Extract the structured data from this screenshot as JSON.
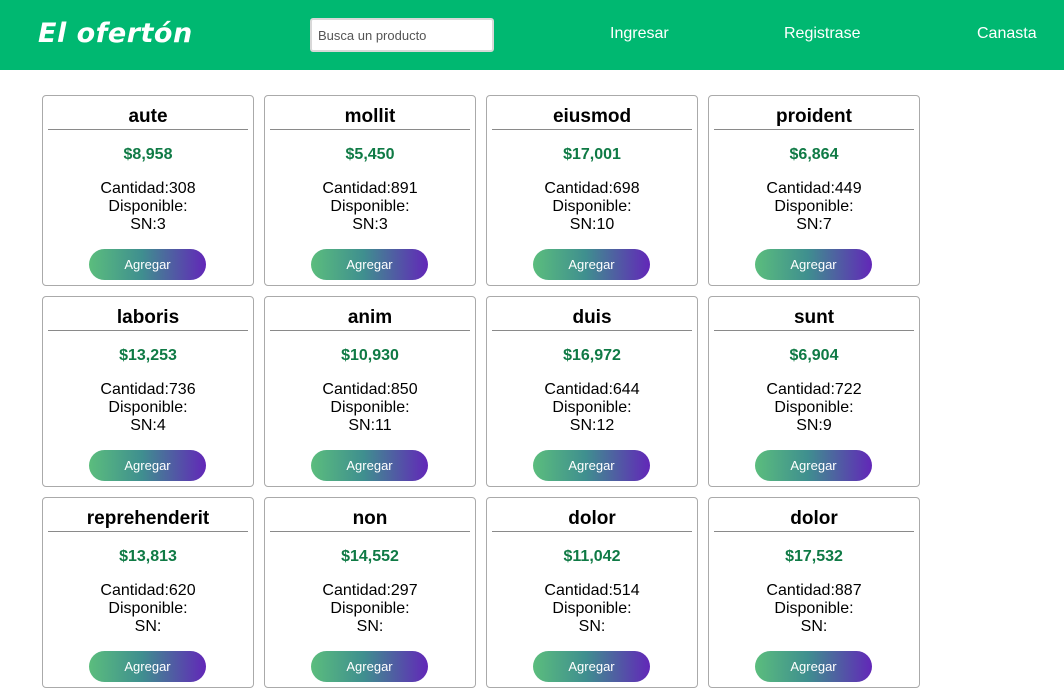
{
  "header": {
    "logo": "El ofertón",
    "search_placeholder": "Busca un producto",
    "nav": {
      "login": "Ingresar",
      "register": "Registrase",
      "cart": "Canasta"
    }
  },
  "labels": {
    "quantity": "Cantidad:",
    "available": "Disponible:",
    "sn": "SN:",
    "add": "Agregar"
  },
  "products": [
    {
      "name": "aute",
      "price": "$8,958",
      "quantity": "308",
      "sn": "3"
    },
    {
      "name": "mollit",
      "price": "$5,450",
      "quantity": "891",
      "sn": "3"
    },
    {
      "name": "eiusmod",
      "price": "$17,001",
      "quantity": "698",
      "sn": "10"
    },
    {
      "name": "proident",
      "price": "$6,864",
      "quantity": "449",
      "sn": "7"
    },
    {
      "name": "laboris",
      "price": "$13,253",
      "quantity": "736",
      "sn": "4"
    },
    {
      "name": "anim",
      "price": "$10,930",
      "quantity": "850",
      "sn": "11"
    },
    {
      "name": "duis",
      "price": "$16,972",
      "quantity": "644",
      "sn": "12"
    },
    {
      "name": "sunt",
      "price": "$6,904",
      "quantity": "722",
      "sn": "9"
    },
    {
      "name": "reprehenderit",
      "price": "$13,813",
      "quantity": "620",
      "sn": ""
    },
    {
      "name": "non",
      "price": "$14,552",
      "quantity": "297",
      "sn": ""
    },
    {
      "name": "dolor",
      "price": "$11,042",
      "quantity": "514",
      "sn": ""
    },
    {
      "name": "dolor",
      "price": "$17,532",
      "quantity": "887",
      "sn": ""
    }
  ]
}
